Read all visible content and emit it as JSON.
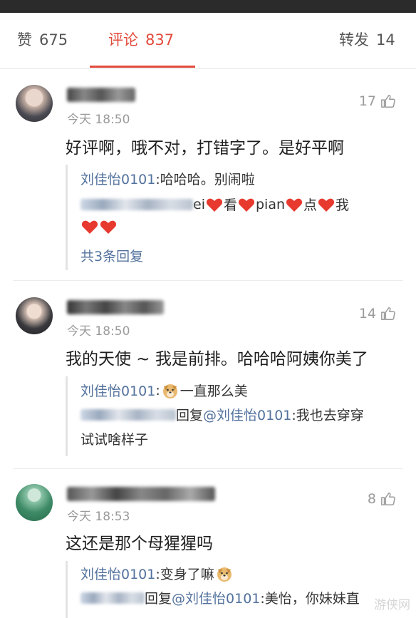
{
  "tabs": {
    "likes": {
      "label": "赞",
      "count": "675"
    },
    "comments": {
      "label": "评论",
      "count": "837"
    },
    "reposts": {
      "label": "转发",
      "count": "14"
    }
  },
  "comments": [
    {
      "time": "今天 18:50",
      "likes": "17",
      "text": "好评啊，哦不对，打错字了。是好平啊",
      "replies": [
        {
          "author": "刘佳怡0101",
          "text": ":哈哈哈。别闹啦"
        },
        {
          "text_parts": [
            "ei",
            "看",
            "pian",
            "点",
            "我"
          ]
        }
      ],
      "more_label": "共3条回复"
    },
    {
      "time": "今天 18:50",
      "likes": "14",
      "text": "我的天使 ~ 我是前排。哈哈哈阿姨你美了",
      "replies": [
        {
          "author": "刘佳怡0101",
          "text": "一直那么美"
        },
        {
          "prefix": "回复 ",
          "mention": "@刘佳怡0101",
          "text": ":我也去穿穿",
          "text_cont": "试试啥样子"
        }
      ]
    },
    {
      "time": "今天 18:53",
      "likes": "8",
      "text": "这还是那个母猩猩吗",
      "replies": [
        {
          "author": "刘佳怡0101",
          "text": ":变身了嘛"
        },
        {
          "prefix": "回复 ",
          "mention": "@刘佳怡0101",
          "text": ":美怡，你妹妹直"
        }
      ]
    }
  ],
  "watermark": "游侠网",
  "colors": {
    "accent": "#e24b3c",
    "link": "#52719d",
    "heart": "#e8392f"
  }
}
